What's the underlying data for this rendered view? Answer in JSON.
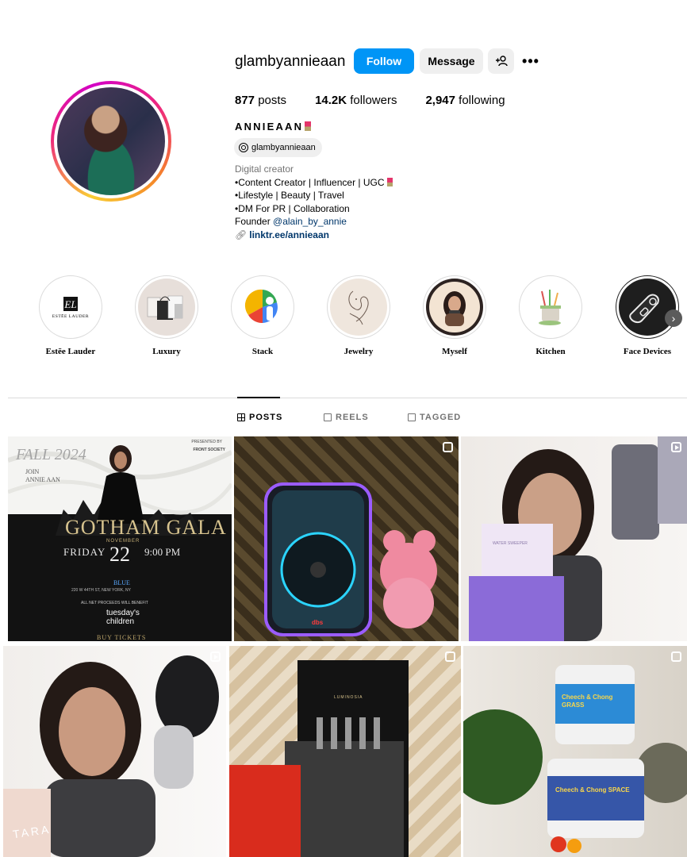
{
  "profile": {
    "username": "glambyannieaan",
    "follow_label": "Follow",
    "message_label": "Message",
    "add_user_label": "+ዶ",
    "more_label": "•••",
    "stats": {
      "posts": "877",
      "posts_label": "posts",
      "followers": "14.2K",
      "followers_label": "followers",
      "following": "2,947",
      "following_label": "following"
    },
    "full_name": "ANNIEAAN",
    "threads_handle": "glambyannieaan",
    "category": "Digital creator",
    "bio_lines": [
      "•Content Creator | Influencer | UGC",
      "•Lifestyle | Beauty | Travel",
      "•DM For PR | Collaboration"
    ],
    "founder_prefix": "Founder ",
    "founder_mention": "@alain_by_annie",
    "link_icon": "link-icon",
    "link": "linktr.ee/annieaan"
  },
  "highlights": [
    {
      "label": "Estēe Lauder",
      "icon": "estee-lauder-logo",
      "logo_text": "ESTĒE LAUDER"
    },
    {
      "label": "Luxury",
      "icon": "shopping-bags"
    },
    {
      "label": "Stack",
      "icon": "stack-logo"
    },
    {
      "label": "Jewelry",
      "icon": "line-art-face"
    },
    {
      "label": "Myself",
      "icon": "portrait-illustration"
    },
    {
      "label": "Kitchen",
      "icon": "kitchen-utensils"
    },
    {
      "label": "Face Devices",
      "icon": "face-device"
    }
  ],
  "tabs": [
    {
      "label": "POSTS",
      "active": true
    },
    {
      "label": "REELS",
      "active": false
    },
    {
      "label": "TAGGED",
      "active": false
    }
  ],
  "posts": [
    {
      "kind": "event-poster",
      "badge": "none",
      "texts": {
        "season": "FALL 2024",
        "presented": "PRESENTED BY",
        "sponsor": "FRONT SOCIETY",
        "join": "JOIN",
        "host": "ANNIE AAN",
        "title": "GOTHAM GALA",
        "day": "FRIDAY",
        "month": "NOVEMBER",
        "date": "22",
        "time": "9:00 PM",
        "venue": "BLUE",
        "address": "220 W 44TH ST, NEW YORK, NY",
        "benefit": "ALL NET PROCEEDS WILL BENEFIT",
        "charity_line1": "tuesday's",
        "charity_line2": "children",
        "cta": "BUY TICKETS"
      }
    },
    {
      "kind": "speaker-and-rose-bear",
      "badge": "multiple",
      "speaker_text": "dbs"
    },
    {
      "kind": "skincare-bottle-selfie",
      "badge": "reel",
      "box_text": "WATER SWEEPER"
    },
    {
      "kind": "cleansing-device-selfie",
      "badge": "reel",
      "box_text": "TARA"
    },
    {
      "kind": "perfume-box-roses",
      "badge": "multiple",
      "box_text": "LUMINOSIA"
    },
    {
      "kind": "gummy-jars",
      "badge": "multiple",
      "jar_text_1": "Cheech & Chong GRASS",
      "jar_text_2": "Cheech & Chong SPACE"
    }
  ]
}
